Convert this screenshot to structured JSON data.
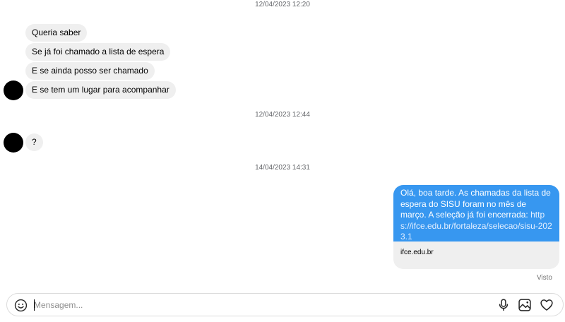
{
  "thread": {
    "timestamps": [
      "12/04/2023 12:20",
      "12/04/2023 12:44",
      "14/04/2023 14:31"
    ],
    "incoming_group1": [
      "Queria saber",
      "Se já foi chamado a lista de espera",
      "E se ainda posso ser chamado",
      "E se tem um lugar para acompanhar"
    ],
    "incoming_group2": [
      "?"
    ],
    "outgoing": {
      "text": "Olá, boa tarde. As chamadas da lista de espera do SISU foram no mês de março. A seleção já foi encerrada:",
      "link": "https://ifce.edu.br/fortaleza/selecao/sisu-2023.1",
      "preview_domain": "ifce.edu.br"
    },
    "seen_label": "Visto"
  },
  "composer": {
    "placeholder": "Mensagem..."
  },
  "icons": {
    "emoji": "emoji-icon",
    "mic": "microphone-icon",
    "image": "image-icon",
    "like": "heart-icon"
  },
  "colors": {
    "outgoing_bubble": "#3797f0",
    "incoming_bubble": "#efefef"
  }
}
